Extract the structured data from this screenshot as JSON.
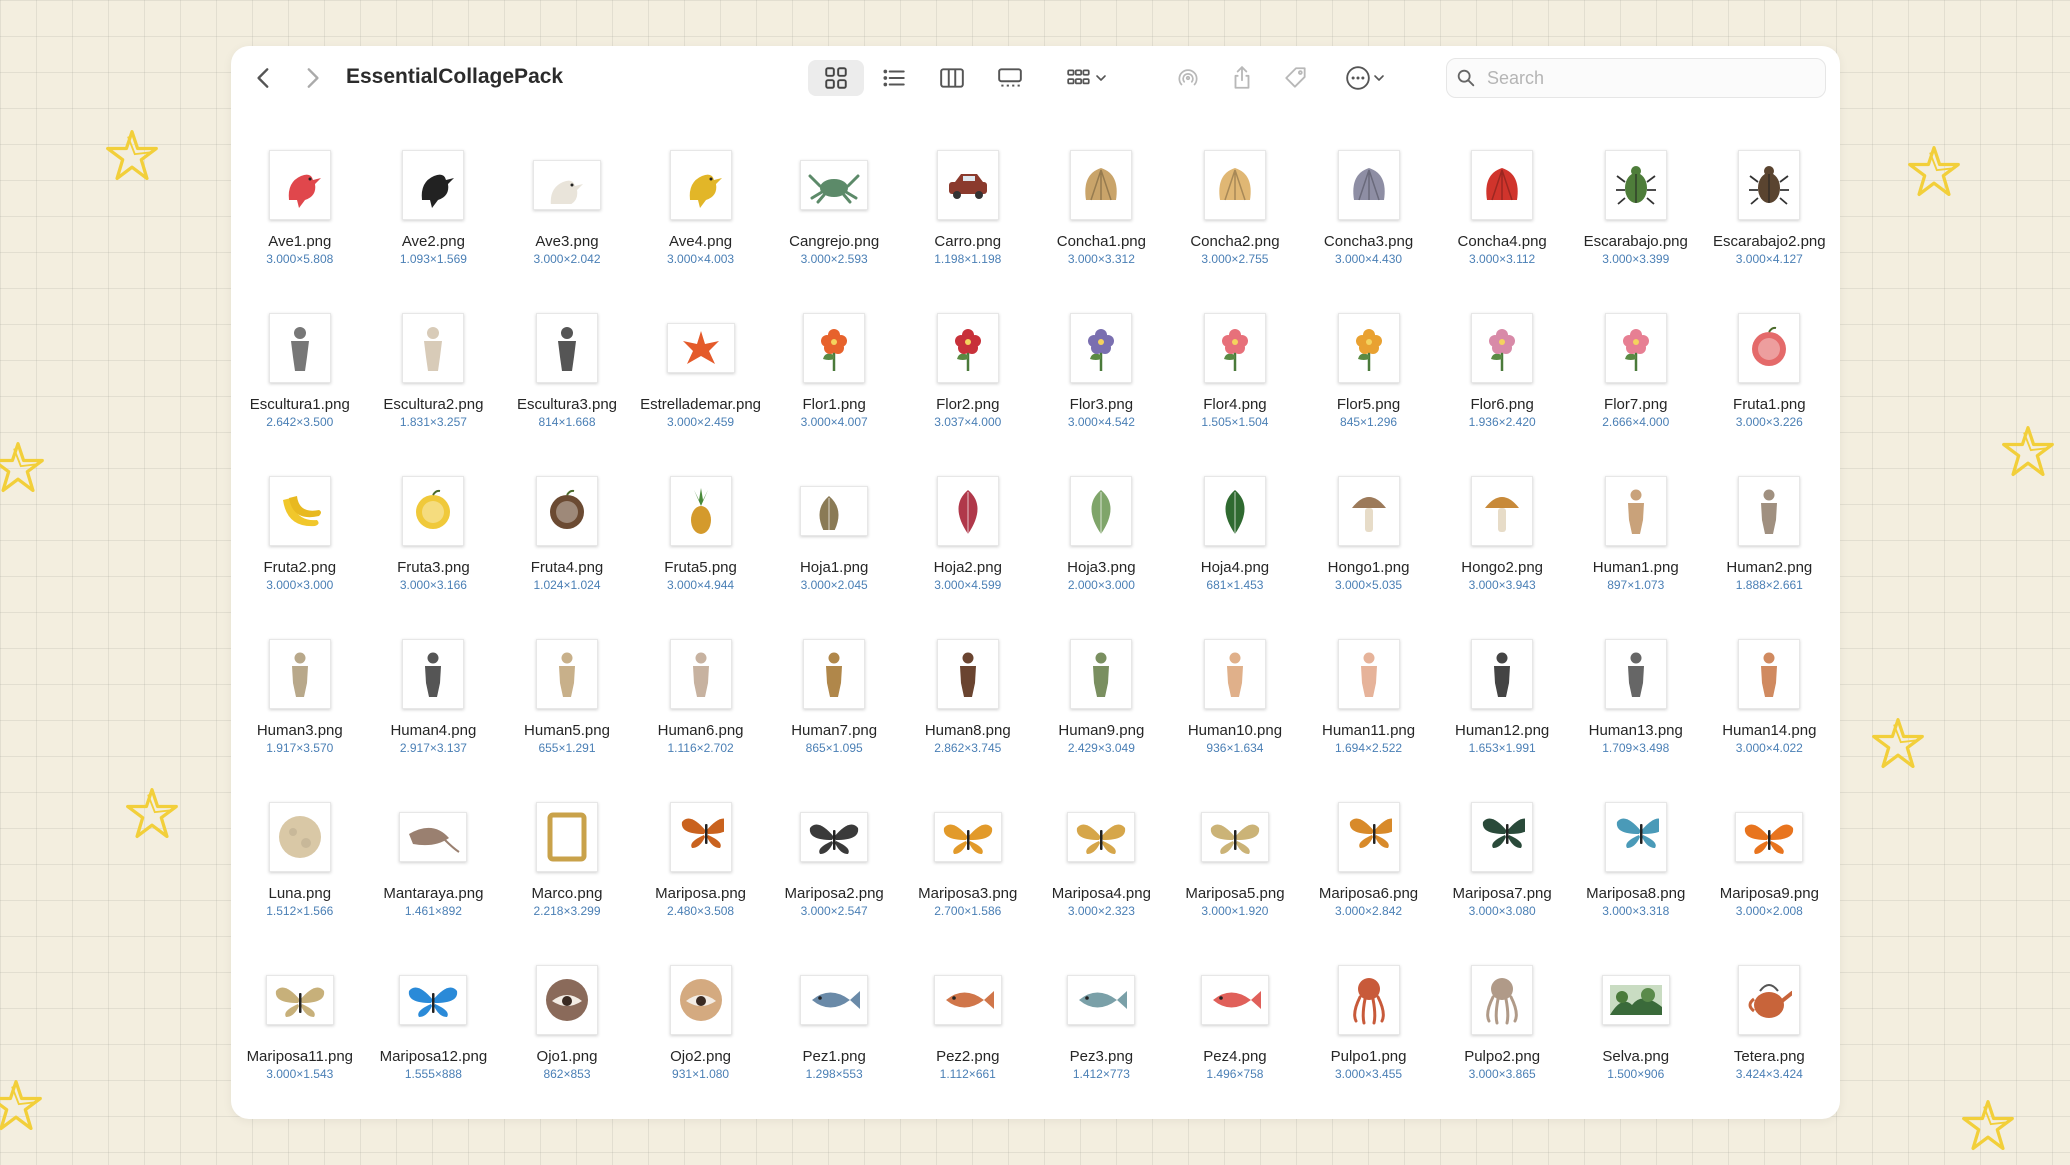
{
  "window": {
    "title": "EssentialCollagePack"
  },
  "toolbar": {
    "back_icon": "chevron-left-icon",
    "forward_icon": "chevron-right-icon",
    "view_icons": [
      "icon-view-grid-icon",
      "list-view-icon",
      "column-view-icon",
      "gallery-view-icon",
      "group-by-icon"
    ],
    "airdrop_icon": "airdrop-icon",
    "share_icon": "share-icon",
    "tag_icon": "tag-icon",
    "more_icon": "ellipsis-circle-icon"
  },
  "search": {
    "placeholder": "Search"
  },
  "colors": {
    "accent_dims": "#4a7fb5",
    "star": "#f2cf3a",
    "background": "#f3eedf"
  },
  "files": [
    {
      "name": "Ave1.png",
      "dims": "3.000×5.808",
      "icon": "bird",
      "color": "#e0474c"
    },
    {
      "name": "Ave2.png",
      "dims": "1.093×1.569",
      "icon": "bird",
      "color": "#222222"
    },
    {
      "name": "Ave3.png",
      "dims": "3.000×2.042",
      "icon": "bird",
      "color": "#e9e4da",
      "wide": true
    },
    {
      "name": "Ave4.png",
      "dims": "3.000×4.003",
      "icon": "bird",
      "color": "#e2b628"
    },
    {
      "name": "Cangrejo.png",
      "dims": "3.000×2.593",
      "icon": "crab",
      "color": "#5c8a69",
      "wide": true
    },
    {
      "name": "Carro.png",
      "dims": "1.198×1.198",
      "icon": "car",
      "color": "#8b3a2d"
    },
    {
      "name": "Concha1.png",
      "dims": "3.000×3.312",
      "icon": "shell",
      "color": "#c9a46a"
    },
    {
      "name": "Concha2.png",
      "dims": "3.000×2.755",
      "icon": "shell",
      "color": "#e0b774"
    },
    {
      "name": "Concha3.png",
      "dims": "3.000×4.430",
      "icon": "shell",
      "color": "#8e8ea4"
    },
    {
      "name": "Concha4.png",
      "dims": "3.000×3.112",
      "icon": "shell",
      "color": "#d0342c"
    },
    {
      "name": "Escarabajo.png",
      "dims": "3.000×3.399",
      "icon": "beetle",
      "color": "#4e7d3a"
    },
    {
      "name": "Escarabajo2.png",
      "dims": "3.000×4.127",
      "icon": "beetle",
      "color": "#5a4430"
    },
    {
      "name": "Escultura1.png",
      "dims": "2.642×3.500",
      "icon": "statue",
      "color": "#777777"
    },
    {
      "name": "Escultura2.png",
      "dims": "1.831×3.257",
      "icon": "statue",
      "color": "#d8cbb8"
    },
    {
      "name": "Escultura3.png",
      "dims": "814×1.668",
      "icon": "statue",
      "color": "#555555"
    },
    {
      "name": "Estrellademar.png",
      "dims": "3.000×2.459",
      "icon": "starfish",
      "color": "#e45a2a",
      "wide": true
    },
    {
      "name": "Flor1.png",
      "dims": "3.000×4.007",
      "icon": "flower",
      "color": "#e7622c"
    },
    {
      "name": "Flor2.png",
      "dims": "3.037×4.000",
      "icon": "flower",
      "color": "#c8313a"
    },
    {
      "name": "Flor3.png",
      "dims": "3.000×4.542",
      "icon": "flower",
      "color": "#7a6fb0"
    },
    {
      "name": "Flor4.png",
      "dims": "1.505×1.504",
      "icon": "flower",
      "color": "#e7707a"
    },
    {
      "name": "Flor5.png",
      "dims": "845×1.296",
      "icon": "flower",
      "color": "#e9a131"
    },
    {
      "name": "Flor6.png",
      "dims": "1.936×2.420",
      "icon": "flower",
      "color": "#d88aa8"
    },
    {
      "name": "Flor7.png",
      "dims": "2.666×4.000",
      "icon": "flower",
      "color": "#e77f93"
    },
    {
      "name": "Fruta1.png",
      "dims": "3.000×3.226",
      "icon": "fruit",
      "color": "#e46a6a"
    },
    {
      "name": "Fruta2.png",
      "dims": "3.000×3.000",
      "icon": "banana",
      "color": "#f1c72b"
    },
    {
      "name": "Fruta3.png",
      "dims": "3.000×3.166",
      "icon": "fruit",
      "color": "#f0c93a"
    },
    {
      "name": "Fruta4.png",
      "dims": "1.024×1.024",
      "icon": "fruit",
      "color": "#6b4a32"
    },
    {
      "name": "Fruta5.png",
      "dims": "3.000×4.944",
      "icon": "pineapple",
      "color": "#d49a2c"
    },
    {
      "name": "Hoja1.png",
      "dims": "3.000×2.045",
      "icon": "leaf",
      "color": "#8a7a55",
      "wide": true
    },
    {
      "name": "Hoja2.png",
      "dims": "3.000×4.599",
      "icon": "leaf",
      "color": "#b0384a"
    },
    {
      "name": "Hoja3.png",
      "dims": "2.000×3.000",
      "icon": "leaf",
      "color": "#7fa56a"
    },
    {
      "name": "Hoja4.png",
      "dims": "681×1.453",
      "icon": "leaf",
      "color": "#2f6a30"
    },
    {
      "name": "Hongo1.png",
      "dims": "3.000×5.035",
      "icon": "mushroom",
      "color": "#9c7a5a"
    },
    {
      "name": "Hongo2.png",
      "dims": "3.000×3.943",
      "icon": "mushroom",
      "color": "#c88a3a"
    },
    {
      "name": "Human1.png",
      "dims": "897×1.073",
      "icon": "person",
      "color": "#c9a27a"
    },
    {
      "name": "Human2.png",
      "dims": "1.888×2.661",
      "icon": "person",
      "color": "#a09080"
    },
    {
      "name": "Human3.png",
      "dims": "1.917×3.570",
      "icon": "person",
      "color": "#b8a88a"
    },
    {
      "name": "Human4.png",
      "dims": "2.917×3.137",
      "icon": "person",
      "color": "#555555"
    },
    {
      "name": "Human5.png",
      "dims": "655×1.291",
      "icon": "person",
      "color": "#c8b08a"
    },
    {
      "name": "Human6.png",
      "dims": "1.116×2.702",
      "icon": "person",
      "color": "#c7b2a0"
    },
    {
      "name": "Human7.png",
      "dims": "865×1.095",
      "icon": "person",
      "color": "#b0874a"
    },
    {
      "name": "Human8.png",
      "dims": "2.862×3.745",
      "icon": "person",
      "color": "#6a4430"
    },
    {
      "name": "Human9.png",
      "dims": "2.429×3.049",
      "icon": "person",
      "color": "#7a8f60"
    },
    {
      "name": "Human10.png",
      "dims": "936×1.634",
      "icon": "person",
      "color": "#e0b08a"
    },
    {
      "name": "Human11.png",
      "dims": "1.694×2.522",
      "icon": "person",
      "color": "#e6b39a"
    },
    {
      "name": "Human12.png",
      "dims": "1.653×1.991",
      "icon": "person",
      "color": "#444444"
    },
    {
      "name": "Human13.png",
      "dims": "1.709×3.498",
      "icon": "person",
      "color": "#666666"
    },
    {
      "name": "Human14.png",
      "dims": "3.000×4.022",
      "icon": "person",
      "color": "#d08a60"
    },
    {
      "name": "Luna.png",
      "dims": "1.512×1.566",
      "icon": "moon",
      "color": "#d9c8a6"
    },
    {
      "name": "Mantaraya.png",
      "dims": "1.461×892",
      "icon": "ray",
      "color": "#9a8070",
      "wide": true
    },
    {
      "name": "Marco.png",
      "dims": "2.218×3.299",
      "icon": "frame",
      "color": "#c9a24a"
    },
    {
      "name": "Mariposa.png",
      "dims": "2.480×3.508",
      "icon": "butterfly",
      "color": "#c9621e"
    },
    {
      "name": "Mariposa2.png",
      "dims": "3.000×2.547",
      "icon": "butterfly",
      "color": "#3a3a3a",
      "wide": true
    },
    {
      "name": "Mariposa3.png",
      "dims": "2.700×1.586",
      "icon": "butterfly",
      "color": "#e29a2a",
      "wide": true
    },
    {
      "name": "Mariposa4.png",
      "dims": "3.000×2.323",
      "icon": "butterfly",
      "color": "#d6a64a",
      "wide": true
    },
    {
      "name": "Mariposa5.png",
      "dims": "3.000×1.920",
      "icon": "butterfly",
      "color": "#cbb377",
      "wide": true
    },
    {
      "name": "Mariposa6.png",
      "dims": "3.000×2.842",
      "icon": "butterfly",
      "color": "#d88a2a"
    },
    {
      "name": "Mariposa7.png",
      "dims": "3.000×3.080",
      "icon": "butterfly",
      "color": "#2a4a3a"
    },
    {
      "name": "Mariposa8.png",
      "dims": "3.000×3.318",
      "icon": "butterfly",
      "color": "#4a9ab8"
    },
    {
      "name": "Mariposa9.png",
      "dims": "3.000×2.008",
      "icon": "butterfly",
      "color": "#e8741e",
      "wide": true
    },
    {
      "name": "Mariposa11.png",
      "dims": "3.000×1.543",
      "icon": "butterfly",
      "color": "#c7b07a",
      "wide": true
    },
    {
      "name": "Mariposa12.png",
      "dims": "1.555×888",
      "icon": "butterfly",
      "color": "#2a8ad8",
      "wide": true
    },
    {
      "name": "Ojo1.png",
      "dims": "862×853",
      "icon": "eye",
      "color": "#8a6a5a"
    },
    {
      "name": "Ojo2.png",
      "dims": "931×1.080",
      "icon": "eye",
      "color": "#d4aa80"
    },
    {
      "name": "Pez1.png",
      "dims": "1.298×553",
      "icon": "fish",
      "color": "#6a8aa8",
      "wide": true
    },
    {
      "name": "Pez2.png",
      "dims": "1.112×661",
      "icon": "fish",
      "color": "#d0764a",
      "wide": true
    },
    {
      "name": "Pez3.png",
      "dims": "1.412×773",
      "icon": "fish",
      "color": "#7aa0a8",
      "wide": true
    },
    {
      "name": "Pez4.png",
      "dims": "1.496×758",
      "icon": "fish",
      "color": "#e0605a",
      "wide": true
    },
    {
      "name": "Pulpo1.png",
      "dims": "3.000×3.455",
      "icon": "octopus",
      "color": "#c85a3a"
    },
    {
      "name": "Pulpo2.png",
      "dims": "3.000×3.865",
      "icon": "octopus",
      "color": "#b09a88"
    },
    {
      "name": "Selva.png",
      "dims": "1.500×906",
      "icon": "landscape",
      "color": "#3a6a3a",
      "wide": true
    },
    {
      "name": "Tetera.png",
      "dims": "3.424×3.424",
      "icon": "teapot",
      "color": "#c8643a"
    }
  ]
}
